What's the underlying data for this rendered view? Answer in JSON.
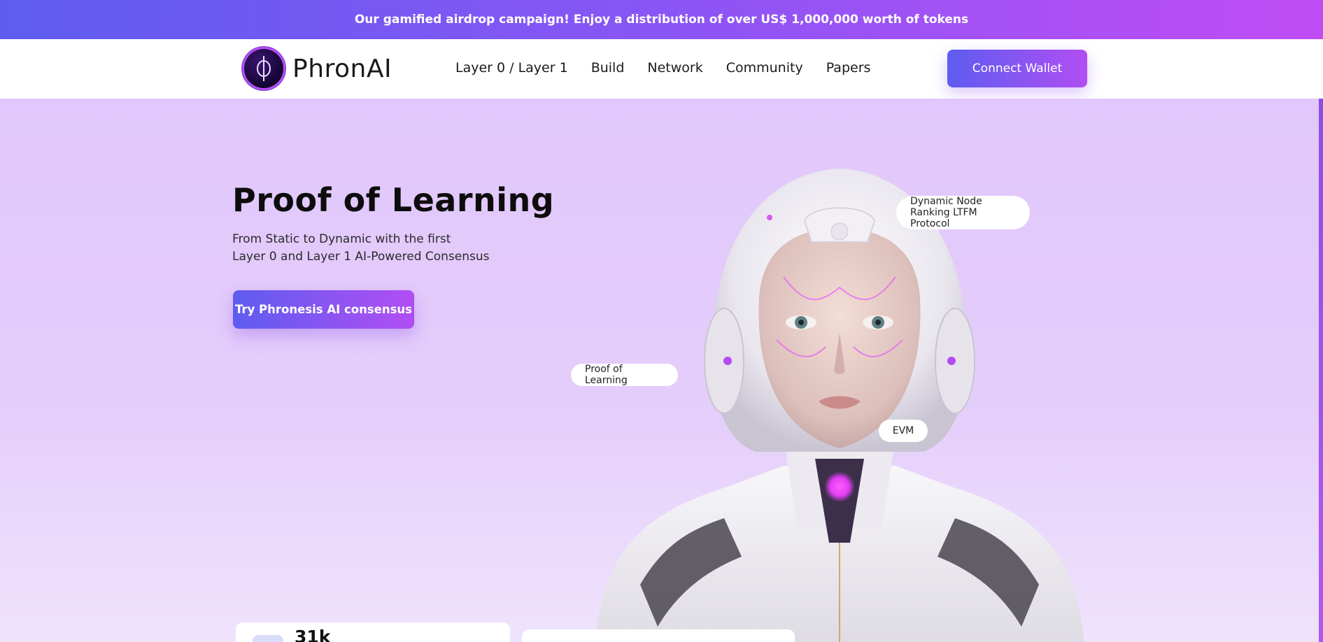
{
  "banner": {
    "text": "Our gamified airdrop campaign! Enjoy a distribution of over US$ 1,000,000 worth of tokens"
  },
  "header": {
    "logo_text": "PhronAI",
    "nav": [
      {
        "label": "Layer 0 / Layer 1"
      },
      {
        "label": "Build"
      },
      {
        "label": "Network"
      },
      {
        "label": "Community"
      },
      {
        "label": "Papers"
      }
    ],
    "connect_label": "Connect Wallet"
  },
  "hero": {
    "title": "Proof of Learning",
    "subtitle_line1": "From Static to Dynamic with the first",
    "subtitle_line2": "Layer 0 and Layer 1 AI-Powered Consensus",
    "cta_label": "Try Phronesis AI consensus",
    "pills": {
      "node_line1": "Dynamic Node",
      "node_line2": "Ranking LTFM Protocol",
      "pol": "Proof of Learning",
      "evm": "EVM"
    }
  },
  "stats": {
    "card1_value": "31k"
  },
  "colors": {
    "accent_start": "#5e5cf0",
    "accent_end": "#c04df4",
    "hero_bg": "#e1c7fb"
  },
  "icons": {
    "logo": "phi-symbol-icon"
  }
}
